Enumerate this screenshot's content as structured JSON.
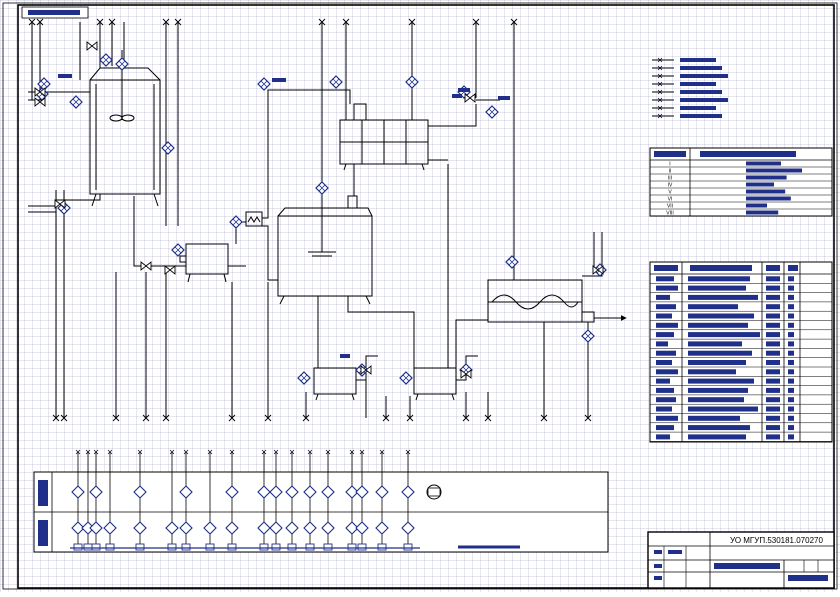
{
  "sheet": {
    "top_tab": "",
    "colors": {
      "line": "#000000",
      "instrument": "#1f2f8a",
      "label_block": "#1f2f8a",
      "grid": "#b4b4d2"
    }
  },
  "legend": {
    "items": [
      "",
      "",
      "",
      "",
      "",
      "",
      "",
      ""
    ]
  },
  "streams_table": {
    "rows": [
      {
        "code": "I",
        "text": ""
      },
      {
        "code": "II",
        "text": ""
      },
      {
        "code": "III",
        "text": ""
      },
      {
        "code": "IV",
        "text": ""
      },
      {
        "code": "V",
        "text": ""
      },
      {
        "code": "VI",
        "text": ""
      },
      {
        "code": "VII",
        "text": ""
      },
      {
        "code": "VIII",
        "text": ""
      }
    ]
  },
  "spec_table": {
    "row_count": 18
  },
  "stamp": {
    "document_code": "УО МГУП.530181.070270"
  }
}
